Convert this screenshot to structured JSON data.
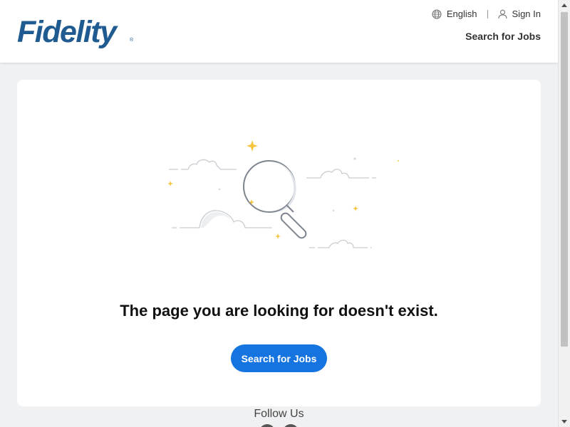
{
  "header": {
    "logo_text": "Fidelity",
    "logo_mark": "®",
    "language_label": "English",
    "signin_label": "Sign In",
    "search_jobs_label": "Search for Jobs",
    "icons": {
      "language": "globe-icon",
      "signin": "user-icon"
    }
  },
  "main": {
    "message": "The page you are looking for doesn't exist.",
    "button_label": "Search for Jobs",
    "illustration": "magnifying-glass-clouds-illustration"
  },
  "footer": {
    "follow_label": "Follow Us"
  },
  "colors": {
    "brand": "#1f5a91",
    "button": "#1574e0",
    "page_bg": "#f0f1f2",
    "sparkle": "#f5c542"
  }
}
